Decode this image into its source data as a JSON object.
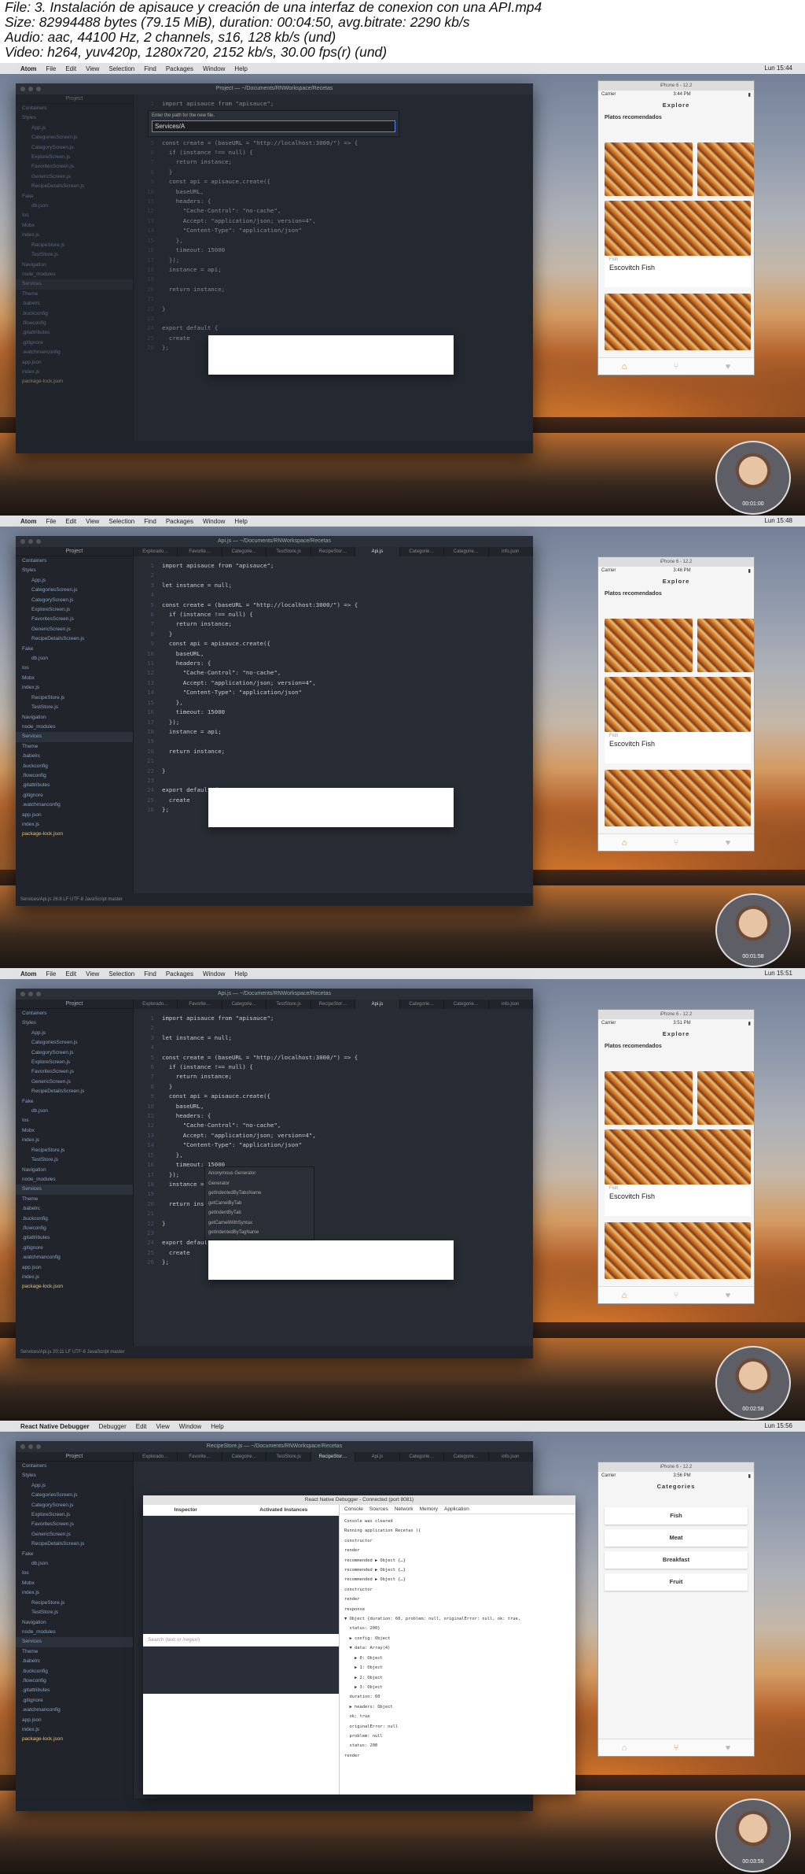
{
  "header": {
    "lines": [
      "File: 3. Instalación de apisauce y creación de una interfaz de conexion con una API.mp4",
      "Size: 82994488 bytes (79.15 MiB), duration: 00:04:50, avg.bitrate: 2290 kb/s",
      "Audio: aac, 44100 Hz, 2 channels, s16, 128 kb/s (und)",
      "Video: h264, yuv420p, 1280x720, 2152 kb/s, 30.00 fps(r) (und)"
    ]
  },
  "frames": [
    {
      "timestamp": "00:01:00",
      "clock": "Lun 15:44",
      "window_title": "Project — ~/Documents/RNWorkspace/Recetas",
      "path_prompt": "Enter the path for the new file.",
      "path_value": "Services/A",
      "sim_time": "3:44 PM",
      "sim_title": "Explore",
      "section": "Platos recomendados",
      "card_title": "Escovitch Fish"
    },
    {
      "timestamp": "00:01:58",
      "clock": "Lun 15:48",
      "window_title": "Api.js — ~/Documents/RNWorkspace/Recetas",
      "sim_time": "3:48 PM",
      "sim_title": "Explore",
      "section": "Platos recomendados",
      "card_title": "Escovitch Fish",
      "status_file": "Services/Api.js",
      "status_pos": "26:8"
    },
    {
      "timestamp": "00:02:58",
      "clock": "Lun 15:51",
      "window_title": "Api.js — ~/Documents/RNWorkspace/Recetas",
      "sim_time": "3:51 PM",
      "sim_title": "Explore",
      "section": "Platos recomendados",
      "card_title": "Escovitch Fish",
      "status_file": "Services/Api.js",
      "status_pos": "20:11",
      "autocomplete": [
        "Anonymous Generator",
        "Generator",
        "getIndentedByTabsName",
        "getCamelByTab",
        "getIndentByTab",
        "getCamelWithSyntax",
        "getIndentedByTagName"
      ]
    },
    {
      "timestamp": "00:03:56",
      "clock": "Lun 15:56",
      "window_title": "RecipeStore.js — ~/Documents/RNWorkspace/Recetas",
      "sim_time": "3:56 PM",
      "sim_title": "Categories",
      "categories": [
        "Fish",
        "Meat",
        "Breakfast",
        "Fruit"
      ],
      "debugger_title": "React Native Debugger - Connected (port 8081)",
      "debugger_tabs": [
        "Console",
        "Sources",
        "Network",
        "Memory",
        "Application"
      ],
      "inspector": "Inspector",
      "actions": "Activated Instances",
      "search_placeholder": "Search (text or /regex/)",
      "console_lines": [
        "Console was cleared",
        "Running application Recetas ({",
        "constructor",
        "render",
        "recommended ▶ Object {…}",
        "recommended ▶ Object {…}",
        "recommended ▶ Object {…}",
        "constructor",
        "render",
        "response",
        "▼ Object {duration: 60, problem: null, originalError: null, ok: true,",
        "  status: 200}",
        "  ▶ config: Object",
        "  ▼ data: Array(4)",
        "    ▶ 0: Object",
        "    ▶ 1: Object",
        "    ▶ 2: Object",
        "    ▶ 3: Object",
        "  duration: 60",
        "  ▶ headers: Object",
        "  ok: true",
        "  originalError: null",
        "  problem: null",
        "  status: 200",
        "render"
      ]
    }
  ],
  "file_tree": [
    "Containers",
    "Styles",
    "App.js",
    "CategoriesScreen.js",
    "CategoryScreen.js",
    "ExploreScreen.js",
    "FavoritesScreen.js",
    "GenericScreen.js",
    "RecipeDetailsScreen.js",
    "Fake",
    "db.json",
    "Ios",
    "Mobx",
    "index.js",
    "RecipeStore.js",
    "TestStore.js",
    "Navigation",
    "node_modules",
    "Services",
    "Theme",
    ".babelrc",
    ".buckconfig",
    ".flowconfig",
    ".gitattributes",
    ".gitignore",
    ".watchmanconfig",
    "app.json",
    "index.js",
    "package-lock.json"
  ],
  "code_api": [
    "import apisauce from \"apisauce\";",
    "",
    "let instance = null;",
    "",
    "const create = (baseURL = \"http://localhost:3000/\") => {",
    "  if (instance !== null) {",
    "    return instance;",
    "  }",
    "  const api = apisauce.create({",
    "    baseURL,",
    "    headers: {",
    "      \"Cache-Control\": \"no-cache\",",
    "      Accept: \"application/json; version=4\",",
    "      \"Content-Type\": \"application/json\"",
    "    },",
    "    timeout: 15000",
    "  });",
    "  instance = api;",
    "",
    "  return instance;",
    "",
    "}",
    "",
    "export default {",
    "  create",
    "};"
  ],
  "menu": [
    "Atom",
    "File",
    "Edit",
    "View",
    "Selection",
    "Find",
    "Packages",
    "Window",
    "Help"
  ]
}
